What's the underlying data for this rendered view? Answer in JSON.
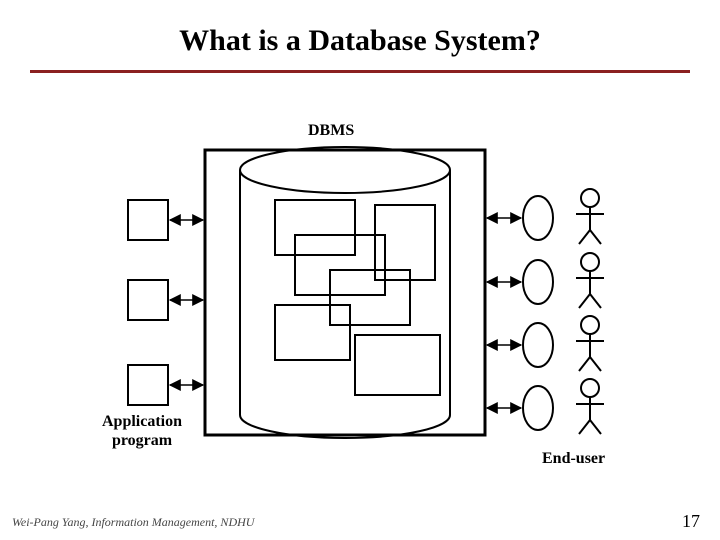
{
  "title": "What is a Database System?",
  "labels": {
    "dbms": "DBMS",
    "app_program": "Application\nprogram",
    "end_user": "End-user"
  },
  "footer": {
    "left": "Wei-Pang Yang, Information Management, NDHU",
    "right": "17"
  }
}
